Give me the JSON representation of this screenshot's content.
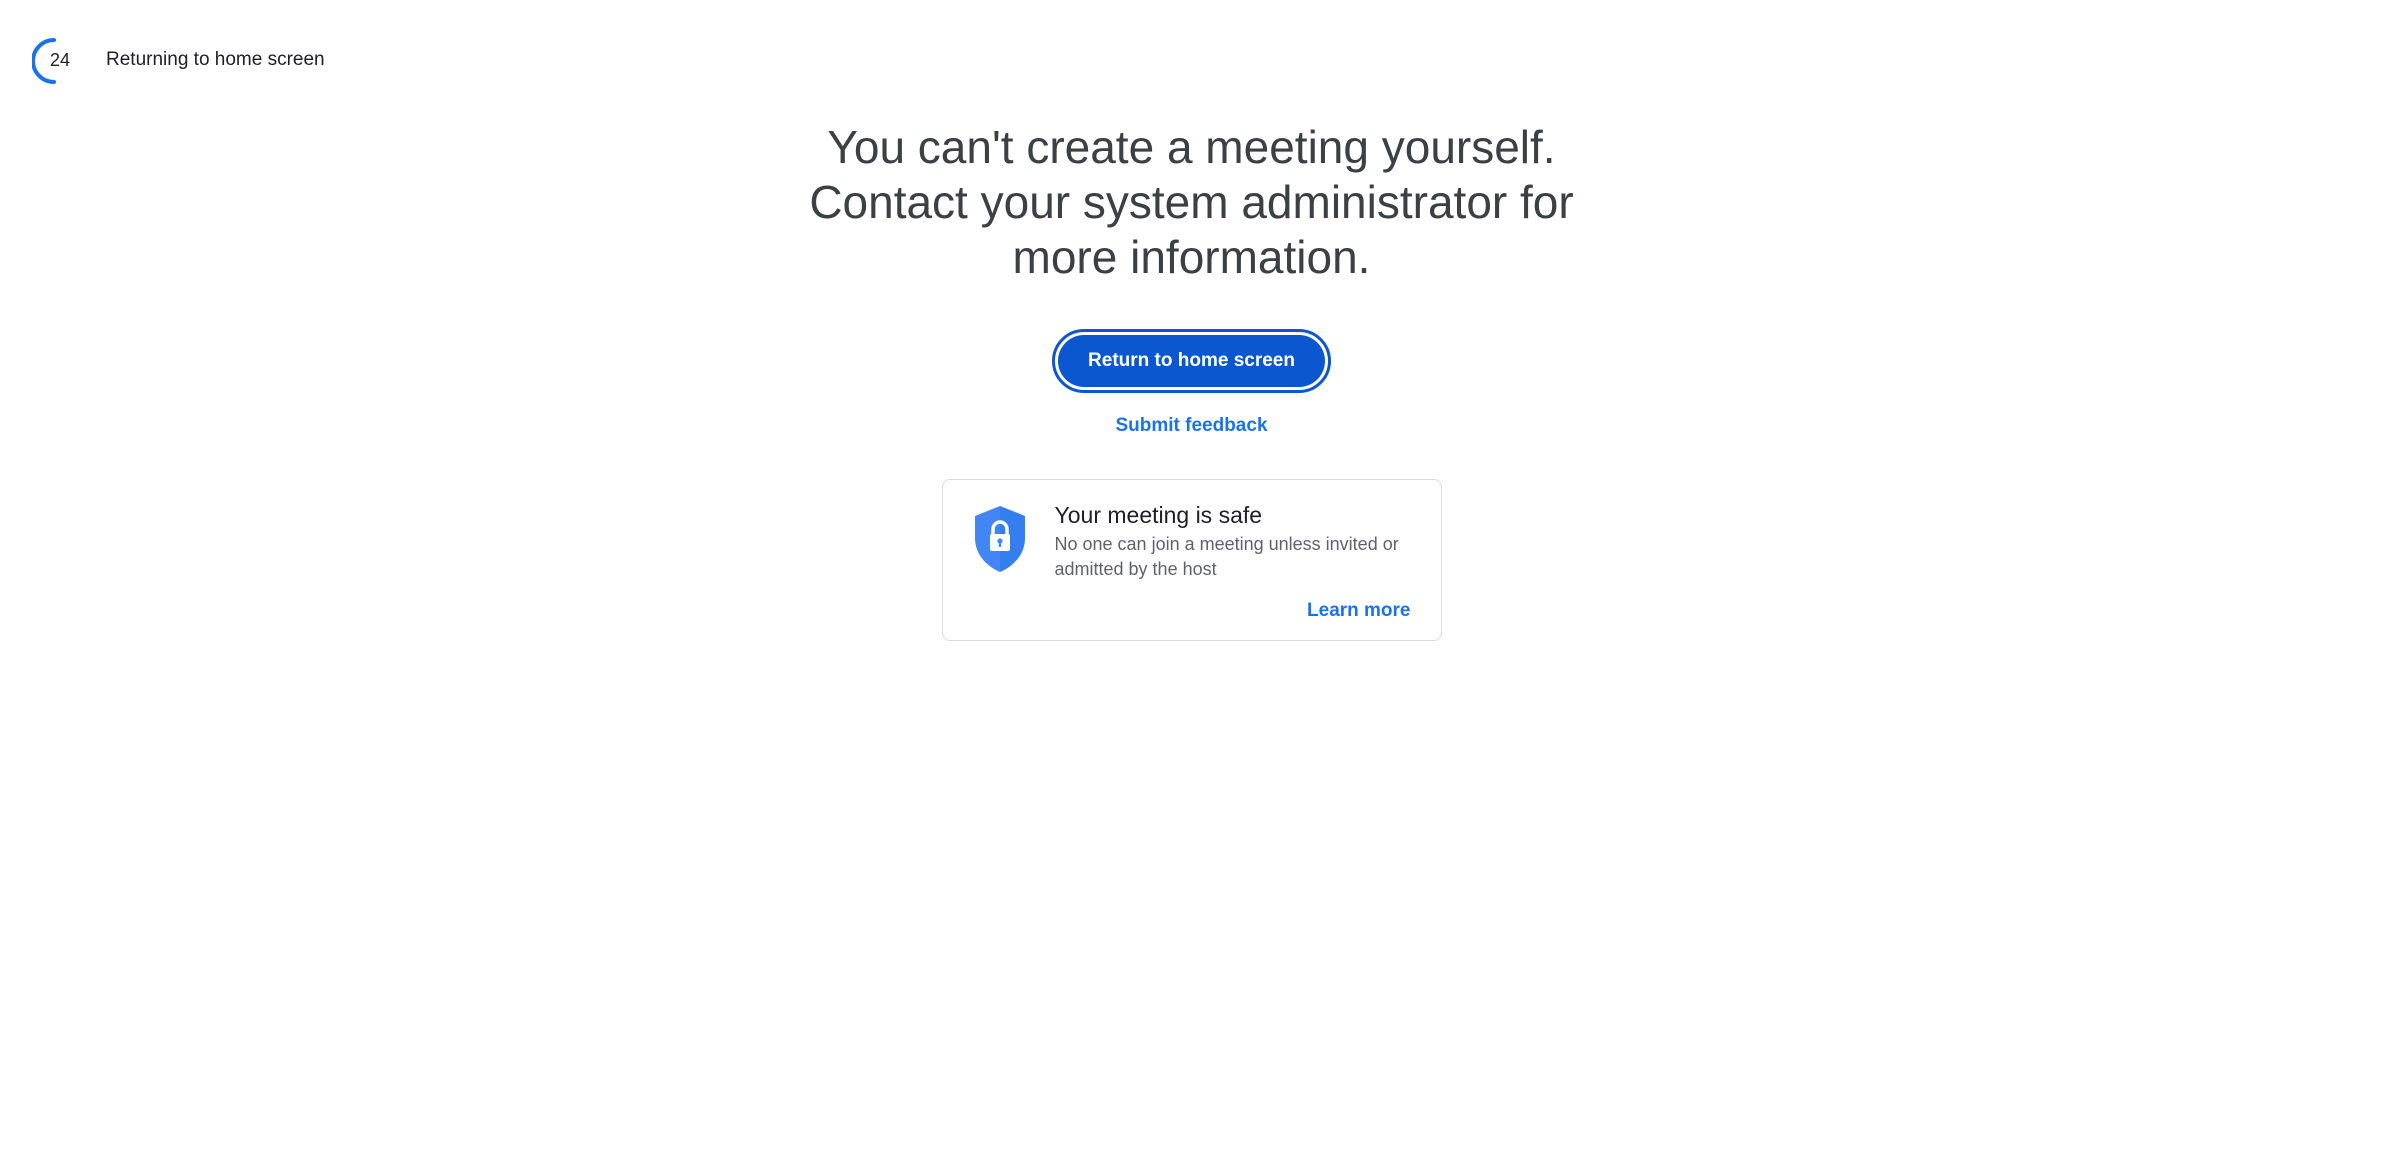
{
  "countdown": {
    "seconds": "24",
    "label": "Returning to home screen"
  },
  "main": {
    "headline": "You can't create a meeting yourself. Contact your system administrator for more information.",
    "return_button_label": "Return to home screen",
    "feedback_link_label": "Submit feedback"
  },
  "safe_card": {
    "icon": "shield-lock-icon",
    "title": "Your meeting is safe",
    "description": "No one can join a meeting unless invited or admitted by the host",
    "learn_more_label": "Learn more"
  },
  "colors": {
    "accent": "#0b57d0",
    "link": "#1a73e8",
    "shield": "#4285f4",
    "text": "#3c4043"
  }
}
